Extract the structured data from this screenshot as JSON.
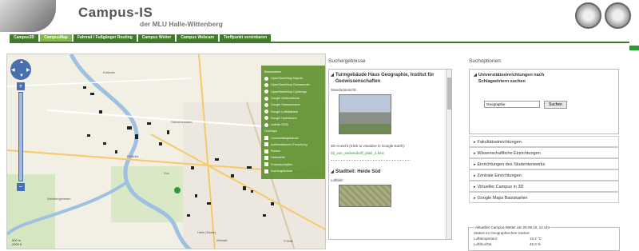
{
  "header": {
    "title": "Campus-IS",
    "subtitle": "der MLU Halle-Wittenberg"
  },
  "nav": {
    "tabs": [
      {
        "label": "Campus3D",
        "active": false
      },
      {
        "label": "CampusMap",
        "active": true
      },
      {
        "label": "Fahrrad / Fußgänger Routing",
        "active": false
      },
      {
        "label": "Campus Wetter",
        "active": false
      },
      {
        "label": "Campus Webcam",
        "active": false
      },
      {
        "label": "Treffpunkt vereinbaren",
        "active": false
      }
    ]
  },
  "map": {
    "layers_title": "Basiskarten",
    "base_layers": [
      "OpenStreetMap Mapnik",
      "OpenStreetMap Osmarender",
      "OpenStreetMap Cyclemap",
      "Google Geländekarte",
      "Google Strassenkarte",
      "Google Luftbildkarte",
      "Google Hybridkarte",
      "Luftbild 2005"
    ],
    "overlays_title": "Overlays",
    "overlays": [
      "Universitätsgebäude",
      "Außenstationen Forschung",
      "Parken",
      "Haltestelle",
      "Postanschlaften",
      "Suchergebnisse"
    ],
    "scale": "500 m\n2000 ft",
    "copyright": "© OSM",
    "labels": [
      "Kröllwitz",
      "Giebichenstein",
      "Zoo",
      "Weinbergwiesen",
      "Halle (Saale)",
      "Altstadt",
      "Peißnitz"
    ]
  },
  "results": {
    "title": "Suchergebnisse",
    "item1_title": "Turmgebäude Haus Geographie, Institut für Geowissenschaften",
    "standort": "Standortansicht:",
    "view3d": "3D-Ansicht (Klick to visualize in Google Earth):",
    "kmz": "03_von_seckendorff_platz_4.kmz",
    "item2_title": "Stadtteil: Heide Süd",
    "luftbild": "Luftbild:"
  },
  "options": {
    "title": "Suchoptionen:",
    "open_section": "Universitätseinrichtungen nach Schlagwörtern suchen",
    "search_value": "Geographie",
    "search_button": "Suchen",
    "sections": [
      "Fakultätseinrichtungen",
      "Wissenschaftliche Einrichtungen",
      "Einrichtungen des Studentenwerks",
      "Zentrale Einrichtungen",
      "Virtueller Campus in 3D",
      "Google Maps Basiskarten"
    ]
  },
  "weather": {
    "title": "Aktuelles Campus-Wetter am 25.08.10, 14 Uhr",
    "station": "Station im Geographischen Garten:",
    "rows": [
      {
        "k": "Lufttemperatur:",
        "v": "16.2 °C"
      },
      {
        "k": "Luftfeuchte:",
        "v": "45.3 %"
      }
    ]
  }
}
